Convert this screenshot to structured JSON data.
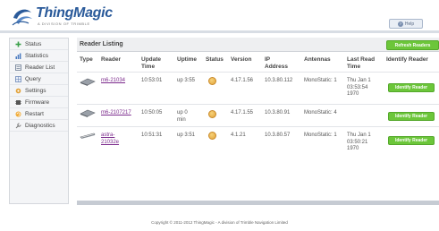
{
  "brand": {
    "name": "ThingMagic",
    "tagline": "A DIVISION OF TRIMBLE"
  },
  "help": {
    "label": "Help"
  },
  "sidebar": {
    "items": [
      {
        "label": "Status",
        "icon": "plus-icon"
      },
      {
        "label": "Statistics",
        "icon": "bar-chart-icon"
      },
      {
        "label": "Reader List",
        "icon": "list-icon"
      },
      {
        "label": "Query",
        "icon": "query-icon"
      },
      {
        "label": "Settings",
        "icon": "gear-icon"
      },
      {
        "label": "Firmware",
        "icon": "chip-icon"
      },
      {
        "label": "Restart",
        "icon": "restart-icon"
      },
      {
        "label": "Diagnostics",
        "icon": "wrench-icon"
      }
    ]
  },
  "listing": {
    "title": "Reader Listing",
    "refresh_label": "Refresh Readers",
    "columns": [
      "Type",
      "Reader",
      "Update Time",
      "Uptime",
      "Status",
      "Version",
      "IP Address",
      "Antennas",
      "Last Read Time",
      "Identify Reader"
    ],
    "rows": [
      {
        "reader": "m6-21034",
        "update_time": "10:53:01",
        "uptime": "up 3:55",
        "version": "4.17.1.56",
        "ip": "10.3.80.112",
        "antennas": "MonoStatic: 1",
        "last_read": "Thu Jan 1 03:53:54 1970",
        "identify_label": "Identify Reader"
      },
      {
        "reader": "m6-2107217",
        "update_time": "10:50:05",
        "uptime": "up 0 min",
        "version": "4.17.1.55",
        "ip": "10.3.80.91",
        "antennas": "MonoStatic: 4",
        "last_read": "",
        "identify_label": "Identify Reader"
      },
      {
        "reader": "astra-21032e",
        "update_time": "10:51:31",
        "uptime": "up 3:51",
        "version": "4.1.21",
        "ip": "10.3.80.57",
        "antennas": "MonoStatic: 1",
        "last_read": "Thu Jan 1 03:50:21 1970",
        "identify_label": "Identify Reader"
      }
    ]
  },
  "footer": {
    "text": "Copyright © 2011-2012 ThingMagic - A division of Trimble Navigation Limited"
  },
  "colors": {
    "accent_green": "#6cc63a",
    "brand_blue": "#2a5a9a",
    "link_purple": "#7b2a8c",
    "status_orange": "#e3a43a"
  }
}
